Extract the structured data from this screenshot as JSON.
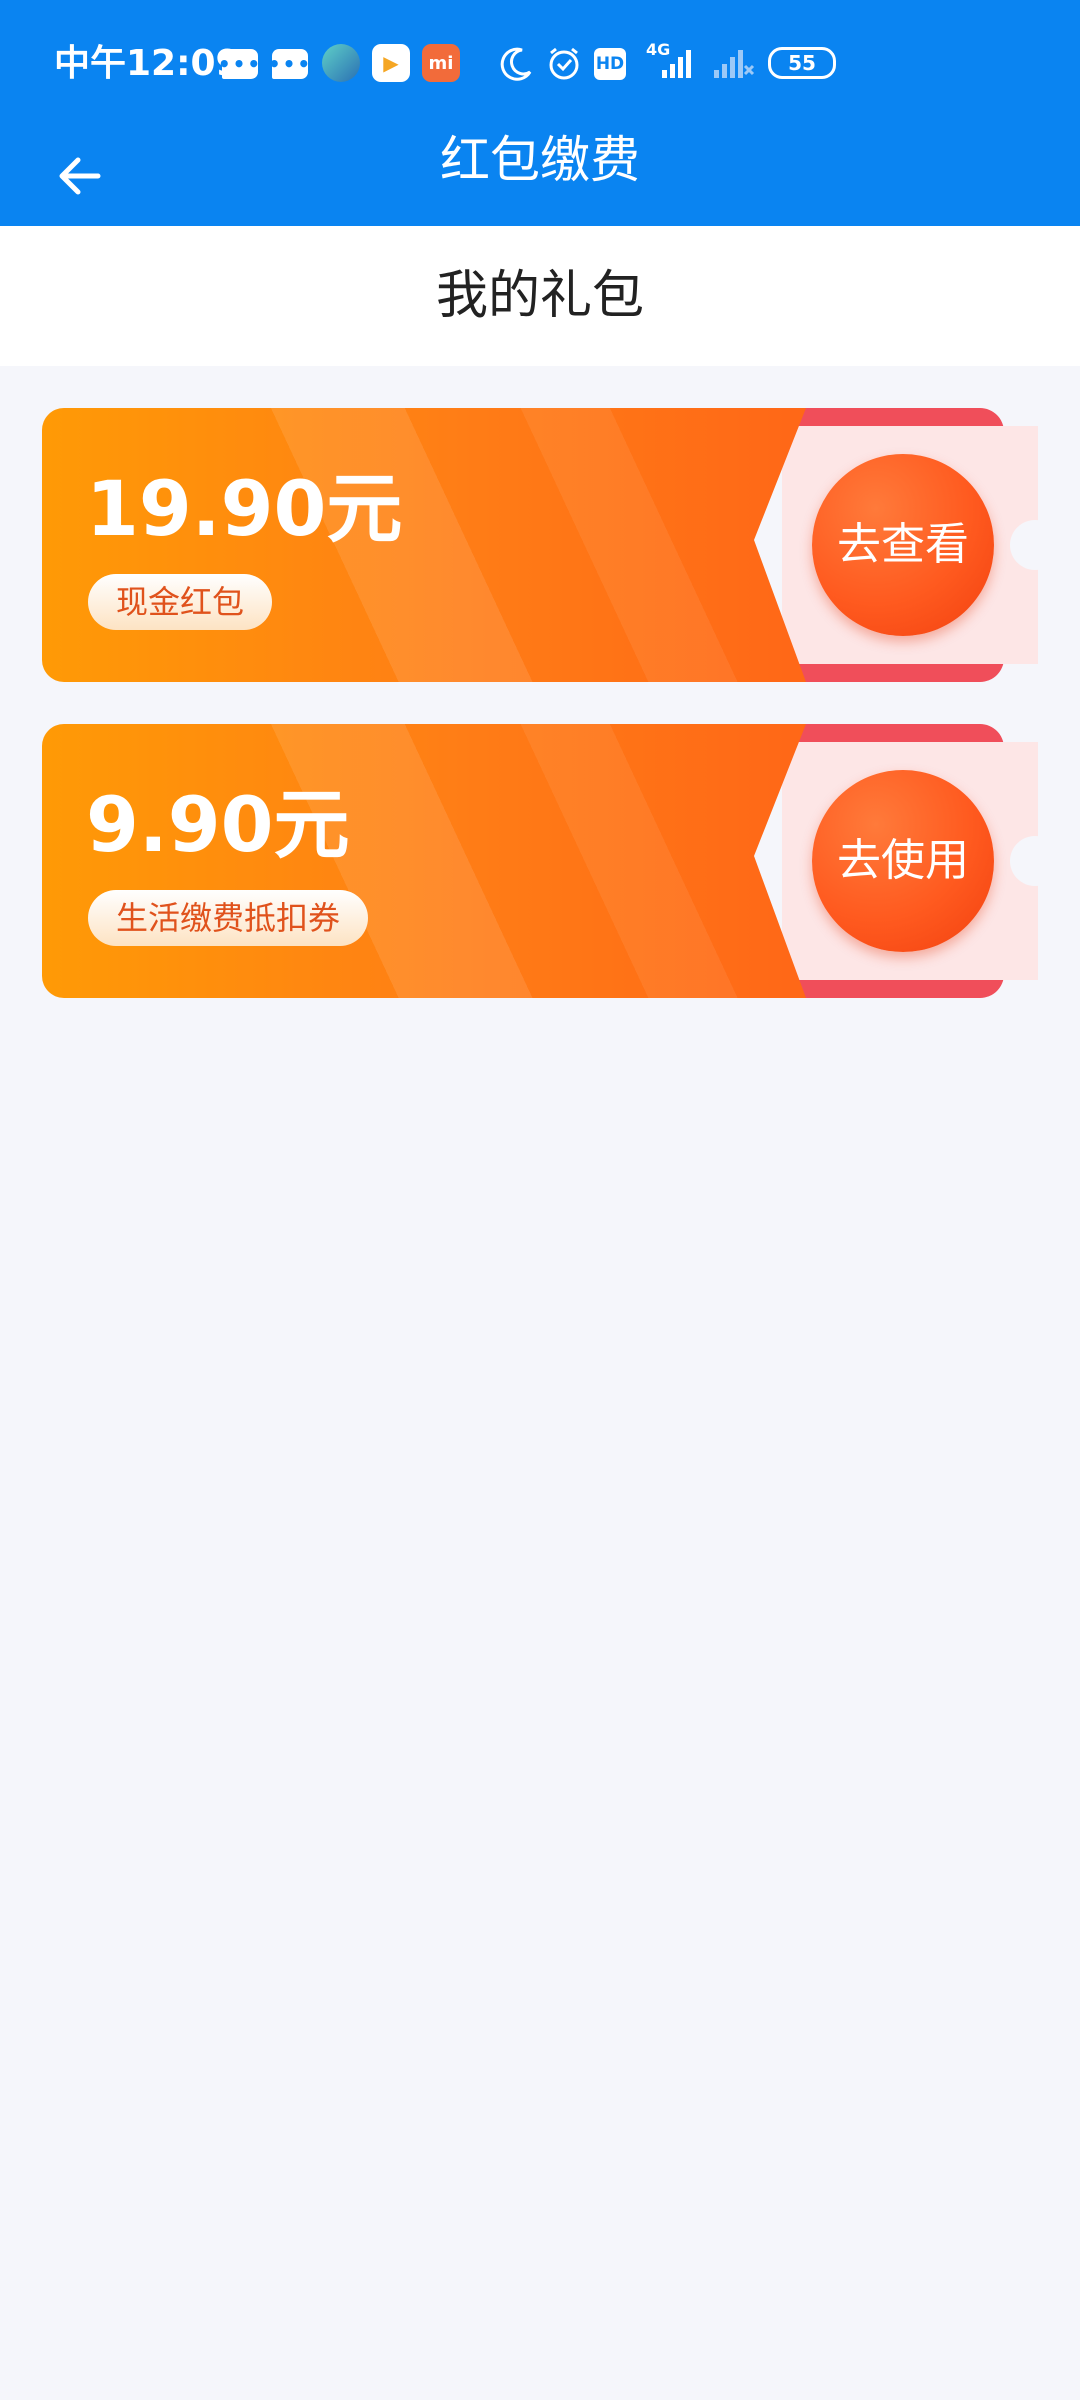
{
  "status_bar": {
    "time": "中午12:09",
    "network": "4G",
    "hd_label": "HD",
    "battery": "55",
    "app_icons": [
      "chat-icon",
      "chat-icon",
      "avatar-app-icon",
      "video-app-icon",
      "mi-icon"
    ],
    "system_icons": [
      "moon-icon",
      "alarm-icon",
      "hd-icon",
      "signal-icon",
      "signal-no-service-icon",
      "battery-icon"
    ]
  },
  "nav": {
    "title": "红包缴费",
    "back_icon": "arrow-left-icon"
  },
  "section": {
    "title": "我的礼包"
  },
  "coupons": [
    {
      "amount": "19.90元",
      "tag": "现金红包",
      "button": "去查看"
    },
    {
      "amount": "9.90元",
      "tag": "生活缴费抵扣券",
      "button": "去使用"
    }
  ],
  "colors": {
    "primary": "#0a84f1",
    "background": "#f5f6fb",
    "coupon_orange": "#ff7d16",
    "coupon_button": "#ff5a1f",
    "coupon_stub": "#fde6e6",
    "tag_text": "#e0521c"
  }
}
